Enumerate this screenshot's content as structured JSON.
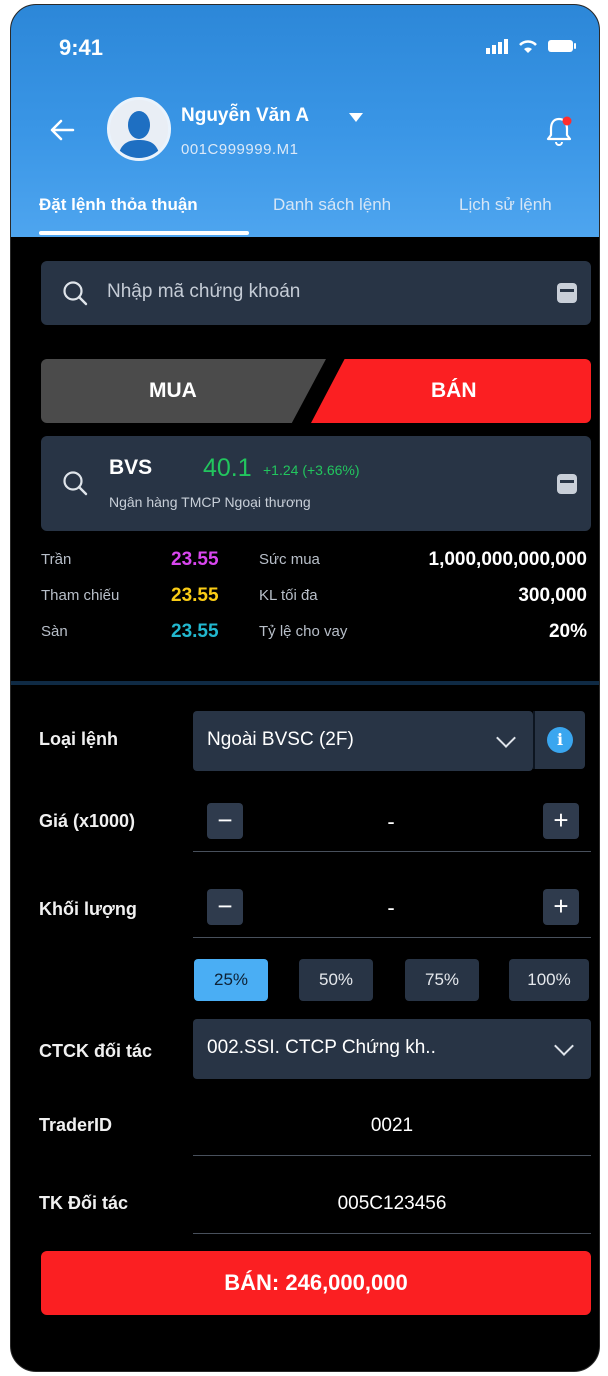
{
  "status": {
    "time": "9:41"
  },
  "user": {
    "name": "Nguyễn Văn A",
    "account": "001C999999.M1"
  },
  "tabs": [
    {
      "label": "Đặt lệnh thỏa thuận"
    },
    {
      "label": "Danh sách lệnh"
    },
    {
      "label": "Lịch sử lệnh"
    }
  ],
  "search": {
    "placeholder": "Nhập mã chứng khoán"
  },
  "side": {
    "buy": "MUA",
    "sell": "BÁN"
  },
  "stock": {
    "symbol": "BVS",
    "price": "40.1",
    "change": "+1.24 (+3.66%)",
    "name": "Ngân hàng TMCP Ngoại thương"
  },
  "info": {
    "ceiling_label": "Trần",
    "ceiling_value": "23.55",
    "ref_label": "Tham chiếu",
    "ref_value": "23.55",
    "floor_label": "Sàn",
    "floor_value": "23.55",
    "buying_power_label": "Sức mua",
    "buying_power_value": "1,000,000,000,000",
    "max_qty_label": "KL tối đa",
    "max_qty_value": "300,000",
    "loan_ratio_label": "Tỷ lệ cho vay",
    "loan_ratio_value": "20%"
  },
  "form": {
    "order_type_label": "Loại lệnh",
    "order_type_value": "Ngoài BVSC (2F)",
    "price_label": "Giá (x1000)",
    "price_value": "-",
    "qty_label": "Khối lượng",
    "qty_value": "-",
    "percents": [
      "25%",
      "50%",
      "75%",
      "100%"
    ],
    "partner_label": "CTCK đối tác",
    "partner_value": "002.SSI. CTCP Chứng kh..",
    "trader_label": "TraderID",
    "trader_value": "0021",
    "partner_acct_label": "TK Đối tác",
    "partner_acct_value": "005C123456",
    "minus": "−",
    "plus": "+",
    "info_glyph": "i"
  },
  "submit": {
    "label": "BÁN: 246,000,000"
  },
  "colors": {
    "header": "#3a96e6",
    "sell": "#fb1f22",
    "buy": "#4b4b4b",
    "ceiling": "#d946ef",
    "reference": "#facc15",
    "floor": "#22b8cf",
    "up": "#22c55e",
    "accent": "#4aaef4"
  }
}
